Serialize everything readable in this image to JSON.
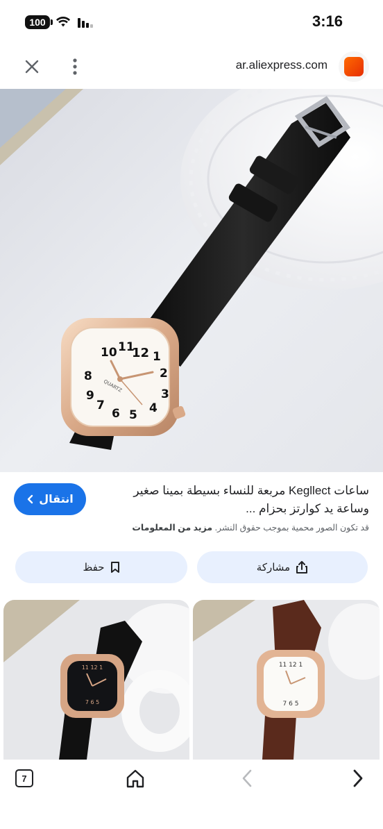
{
  "status_bar": {
    "battery": "100",
    "time": "3:16"
  },
  "browser": {
    "url": "ar.aliexpress.com",
    "favicon_text": "AliExpress",
    "accent": "#1a73e8"
  },
  "result": {
    "title": "ساعات Kegllect مربعة للنساء بسيطة بمينا صغير وساعة يد كوارتز بحزام ...",
    "visit_label": "انتقال",
    "copyright_text": "قد تكون الصور محمية بموجب حقوق النشر.",
    "more_info_label": "مزيد من المعلومات",
    "share_label": "مشاركة",
    "save_label": "حفظ"
  },
  "watch": {
    "dial_numbers": [
      "12",
      "1",
      "2",
      "3",
      "4",
      "5",
      "6",
      "7",
      "8",
      "9",
      "10",
      "11"
    ],
    "brand_text": "QUARTZ"
  },
  "toolbar": {
    "tab_count": "7"
  },
  "icons": {
    "close": "close-icon",
    "more": "more-vert-icon",
    "share": "share-icon",
    "bookmark": "bookmark-icon",
    "chevron": "chevron-left-icon",
    "home": "home-icon",
    "back": "arrow-back-icon",
    "forward": "arrow-forward-icon"
  }
}
